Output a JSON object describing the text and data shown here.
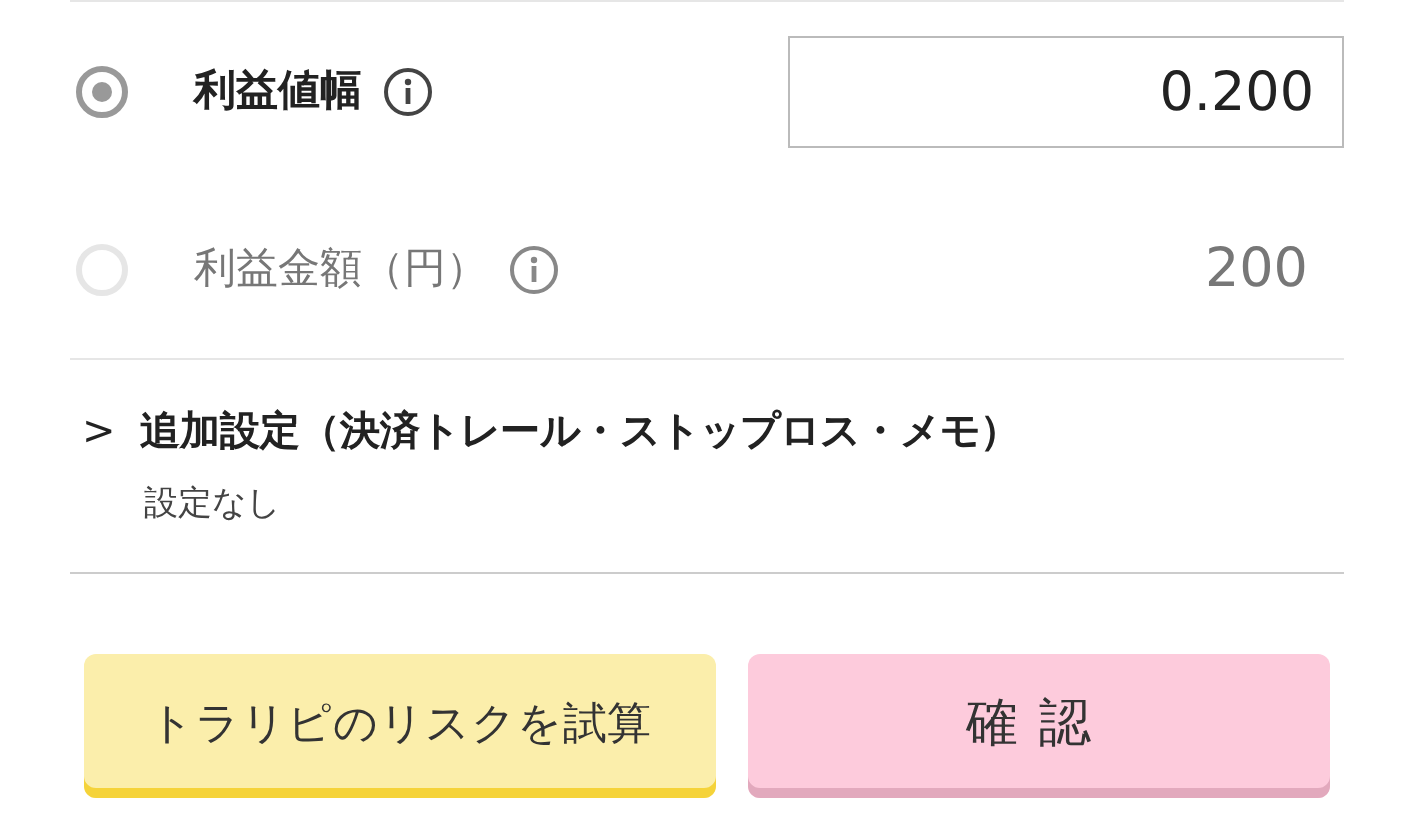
{
  "options": [
    {
      "label": "利益値幅",
      "value": "0.200",
      "selected": true
    },
    {
      "label": "利益金額（円）",
      "value": "200",
      "selected": false
    }
  ],
  "additional": {
    "expander": ">",
    "title": "追加設定（決済トレール・ストップロス・メモ）",
    "summary": "設定なし"
  },
  "buttons": [
    {
      "label": "トラリピのリスクを試算",
      "kind": "secondary"
    },
    {
      "label": "確認",
      "kind": "primary"
    }
  ]
}
